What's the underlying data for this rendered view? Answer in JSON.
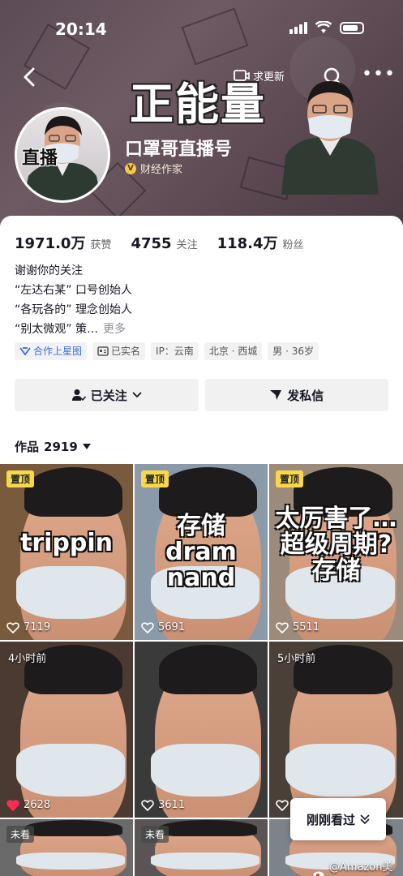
{
  "status_bar": {
    "time": "20:14"
  },
  "header": {
    "update_label": "求更新",
    "banner_title": "正能量",
    "avatar_tag": "直播",
    "username": "口罩哥直播号",
    "verification": "财经作家"
  },
  "stats": [
    {
      "value": "1971.0万",
      "label": "获赞"
    },
    {
      "value": "4755",
      "label": "关注"
    },
    {
      "value": "118.4万",
      "label": "粉丝"
    }
  ],
  "bio": {
    "lines": [
      "谢谢你的关注",
      "“左达右某” 口号创始人",
      "“各玩各的” 理念创始人",
      "“别太微观” 策…"
    ],
    "more": "更多"
  },
  "tags": [
    "合作上星图",
    "已实名",
    "IP：云南",
    "北京 · 西城",
    "男 · 36岁"
  ],
  "buttons": {
    "follow": "已关注",
    "message": "发私信"
  },
  "works": {
    "label": "作品",
    "count": "2919"
  },
  "videos": [
    {
      "badge": "置顶",
      "overlay": "trippin",
      "likes": "7119",
      "bg": "#7a5a3c",
      "liked": false
    },
    {
      "badge": "置顶",
      "overlay": "存储\ndram\nnand",
      "likes": "5691",
      "bg": "#8a9aa8",
      "liked": false
    },
    {
      "badge": "置顶",
      "overlay": "太厉害了…\n超级周期?\n存储",
      "likes": "5511",
      "bg": "#9c8b7a",
      "liked": false
    },
    {
      "time": "4小时前",
      "likes": "2628",
      "bg": "#4b3a32",
      "liked": true
    },
    {
      "time": "",
      "likes": "3611",
      "bg": "#3a3a3a",
      "liked": false
    },
    {
      "time": "5小时前",
      "likes": "",
      "bg": "#4a4038",
      "liked": false
    },
    {
      "badge": "未看",
      "bg": "#6b6a6a"
    },
    {
      "badge": "未看",
      "bg": "#5a5554"
    },
    {
      "badge": "",
      "bg": "#7d8489"
    }
  ],
  "recent_button": "刚刚看过",
  "watermark": "@Amazon美刀"
}
